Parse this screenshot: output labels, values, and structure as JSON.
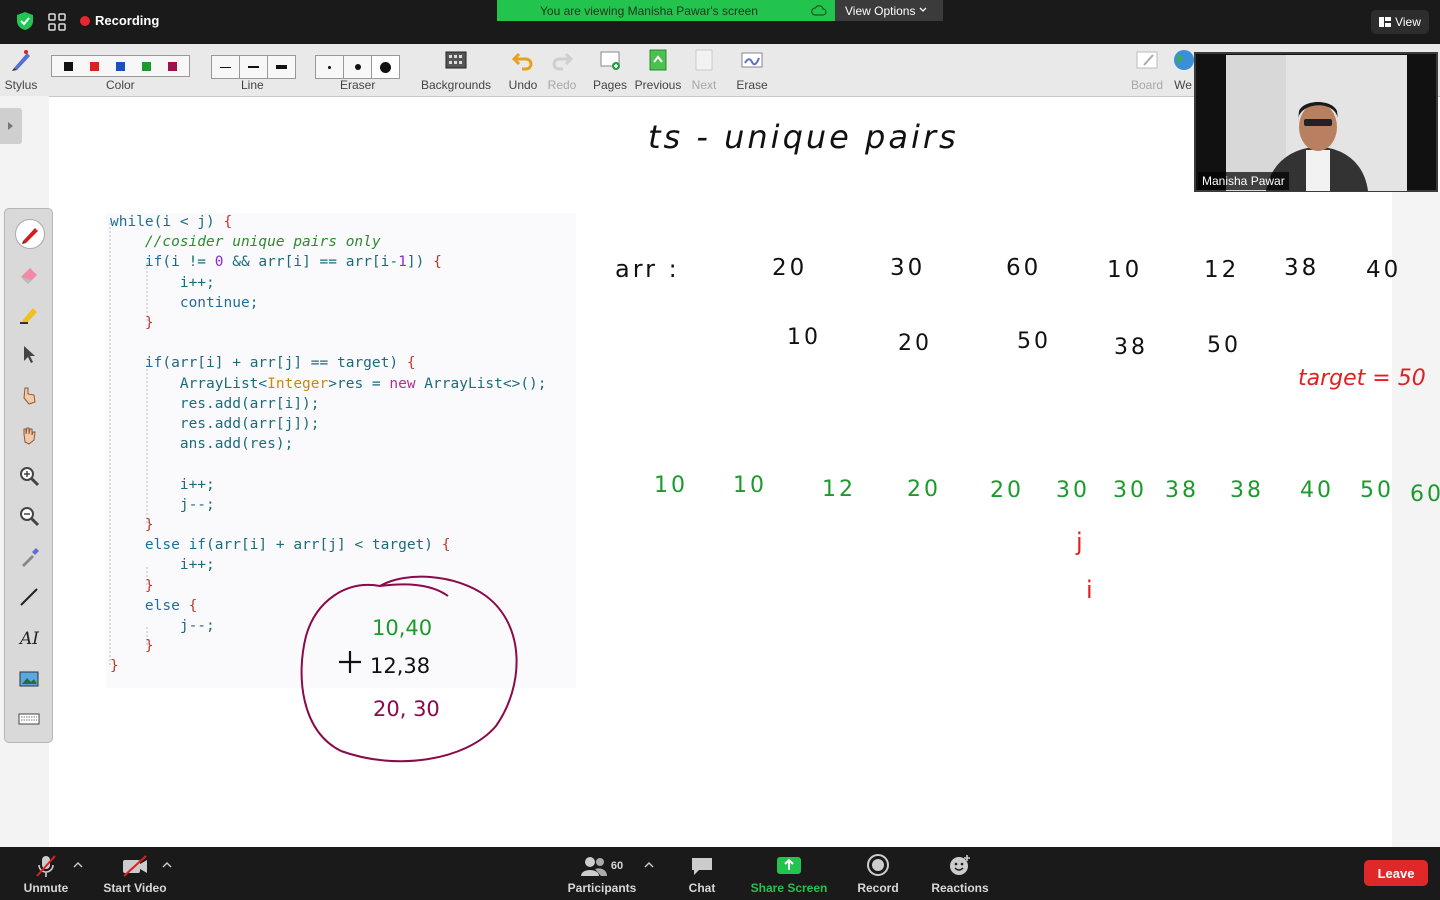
{
  "topbar": {
    "recording_label": "Recording",
    "viewing_banner": "You are viewing Manisha Pawar's screen",
    "view_options_label": "View Options",
    "view_label": "View"
  },
  "toolbar": {
    "stylus": "Stylus",
    "color": "Color",
    "line": "Line",
    "eraser": "Eraser",
    "backgrounds": "Backgrounds",
    "undo": "Undo",
    "redo": "Redo",
    "pages": "Pages",
    "previous": "Previous",
    "next": "Next",
    "erase": "Erase",
    "board": "Board",
    "web": "We",
    "colors": [
      "#111111",
      "#e02020",
      "#1a4fc0",
      "#1c9a2c",
      "#a0124a"
    ]
  },
  "code_lines": [
    "while(i < j) {",
    "    //cosider unique pairs only",
    "    if(i != 0 && arr[i] == arr[i-1]) {",
    "        i++;",
    "        continue;",
    "    }",
    "",
    "    if(arr[i] + arr[j] == target) {",
    "        ArrayList<Integer>res = new ArrayList<>();",
    "        res.add(arr[i]);",
    "        res.add(arr[j]);",
    "        ans.add(res);",
    "",
    "        i++;",
    "        j--;",
    "    }",
    "    else if(arr[i] + arr[j] < target) {",
    "        i++;",
    "    }",
    "    else {",
    "        j--;",
    "    }",
    "}"
  ],
  "whiteboard": {
    "title": "ts - unique pairs",
    "arr_label": "arr :",
    "arr_values": [
      "20",
      "30",
      "60",
      "10",
      "12",
      "38",
      "40"
    ],
    "diff_values": [
      "10",
      "20",
      "50",
      "38",
      "50"
    ],
    "target_label": "target = 50",
    "sorted_values": [
      "10",
      "10",
      "12",
      "20",
      "20",
      "30",
      "30",
      "38",
      "38",
      "40",
      "50",
      "60"
    ],
    "pointer_j": "j",
    "pointer_i": "i",
    "pairs": [
      "10,40",
      "12,38",
      "20, 30"
    ]
  },
  "video": {
    "participant_name": "Manisha Pawar"
  },
  "bottombar": {
    "unmute": "Unmute",
    "start_video": "Start Video",
    "participants": "Participants",
    "participants_count": "60",
    "chat": "Chat",
    "share_screen": "Share Screen",
    "record": "Record",
    "reactions": "Reactions",
    "leave": "Leave"
  }
}
